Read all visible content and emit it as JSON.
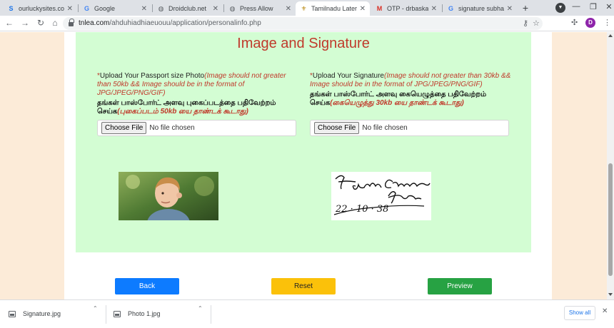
{
  "browser": {
    "tabs": [
      {
        "title": "ourluckysites.com",
        "icon": "s-logo-icon",
        "icon_char": "S",
        "icon_color": "#1a73e8",
        "active": false
      },
      {
        "title": "Google",
        "icon": "google-icon",
        "icon_char": "G",
        "icon_color": "#4285f4",
        "active": false
      },
      {
        "title": "Droidclub.net",
        "icon": "globe-icon",
        "icon_char": "◍",
        "icon_color": "#5f6368",
        "active": false
      },
      {
        "title": "Press Allow",
        "icon": "globe-icon",
        "icon_char": "◍",
        "icon_color": "#5f6368",
        "active": false
      },
      {
        "title": "Tamilnadu Lateral",
        "icon": "emblem-icon",
        "icon_char": "⚜",
        "icon_color": "#b8860b",
        "active": true
      },
      {
        "title": "OTP - drbaskaran",
        "icon": "gmail-icon",
        "icon_char": "M",
        "icon_color": "#d93025",
        "active": false
      },
      {
        "title": "signature subhash",
        "icon": "google-icon",
        "icon_char": "G",
        "icon_color": "#4285f4",
        "active": false
      }
    ],
    "url_host": "tnlea.com",
    "url_path": "/ahduhiadhiaeuouu/application/personalinfo.php",
    "profile_initial": "D"
  },
  "page": {
    "heading": "Image and Signature",
    "photo_section": {
      "required_mark": "*",
      "label": "Upload Your Passport size Photo",
      "note": "(Image should not greater than 50kb && Image should be in the format of JPG/JPEG/PNG/GIF)",
      "tamil": "தங்கள் பாஸ்போர்ட் அளவு புகைப்படத்தை பதிவேற்றம் செய்க",
      "tamil_note": "(புகைப்படம் 50kb யை தாண்டக் கூடாது)",
      "choose_label": "Choose File",
      "no_file": "No file chosen"
    },
    "signature_section": {
      "required_mark": "*",
      "label": "Upload Your Signature",
      "note": "(Image should not greater than 30kb && Image should be in the format of JPG/JPEG/PNG/GIF)",
      "tamil": "தங்கள் பாஸ்போர்ட் அளவு கையெழுத்தை பதிவேற்றம் செய்க",
      "tamil_note": "(கையெழுத்து 30kb யை தாண்டக் கூடாது)",
      "choose_label": "Choose File",
      "no_file": "No file chosen"
    },
    "buttons": {
      "back": "Back",
      "reset": "Reset",
      "preview": "Preview"
    },
    "colors": {
      "back": "#0d7bff",
      "reset": "#fbc10a",
      "preview": "#27a243"
    }
  },
  "downloads": {
    "items": [
      {
        "name": "Signature.jpg"
      },
      {
        "name": "Photo 1.jpg"
      }
    ],
    "show_all": "Show all"
  }
}
